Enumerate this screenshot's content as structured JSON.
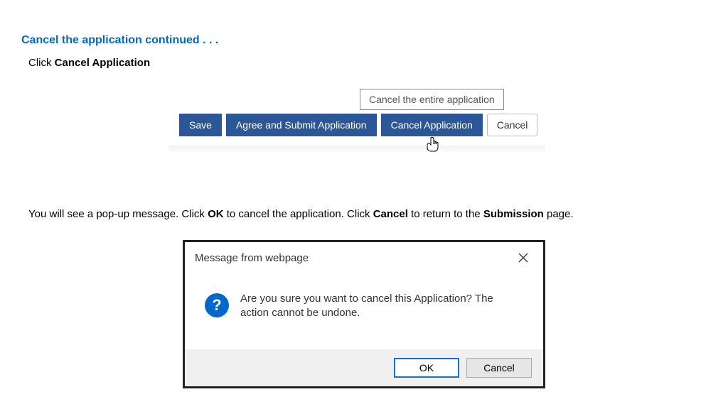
{
  "heading": "Cancel the application continued . . .",
  "instr1_pre": "Click ",
  "instr1_bold": "Cancel Application",
  "tooltip": "Cancel the entire application",
  "buttons": {
    "save": "Save",
    "agree": "Agree and Submit Application",
    "cancel_app": "Cancel Application",
    "cancel": "Cancel"
  },
  "instr2": {
    "t1": "You will see a pop-up message. Click ",
    "b1": "OK",
    "t2": " to cancel the application. Click ",
    "b2": "Cancel",
    "t3": " to return to the ",
    "b3": "Submission",
    "t4": " page."
  },
  "dialog": {
    "title": "Message from webpage",
    "message": "Are you sure you want to cancel this Application? The action cannot be undone.",
    "ok": "OK",
    "cancel": "Cancel"
  }
}
